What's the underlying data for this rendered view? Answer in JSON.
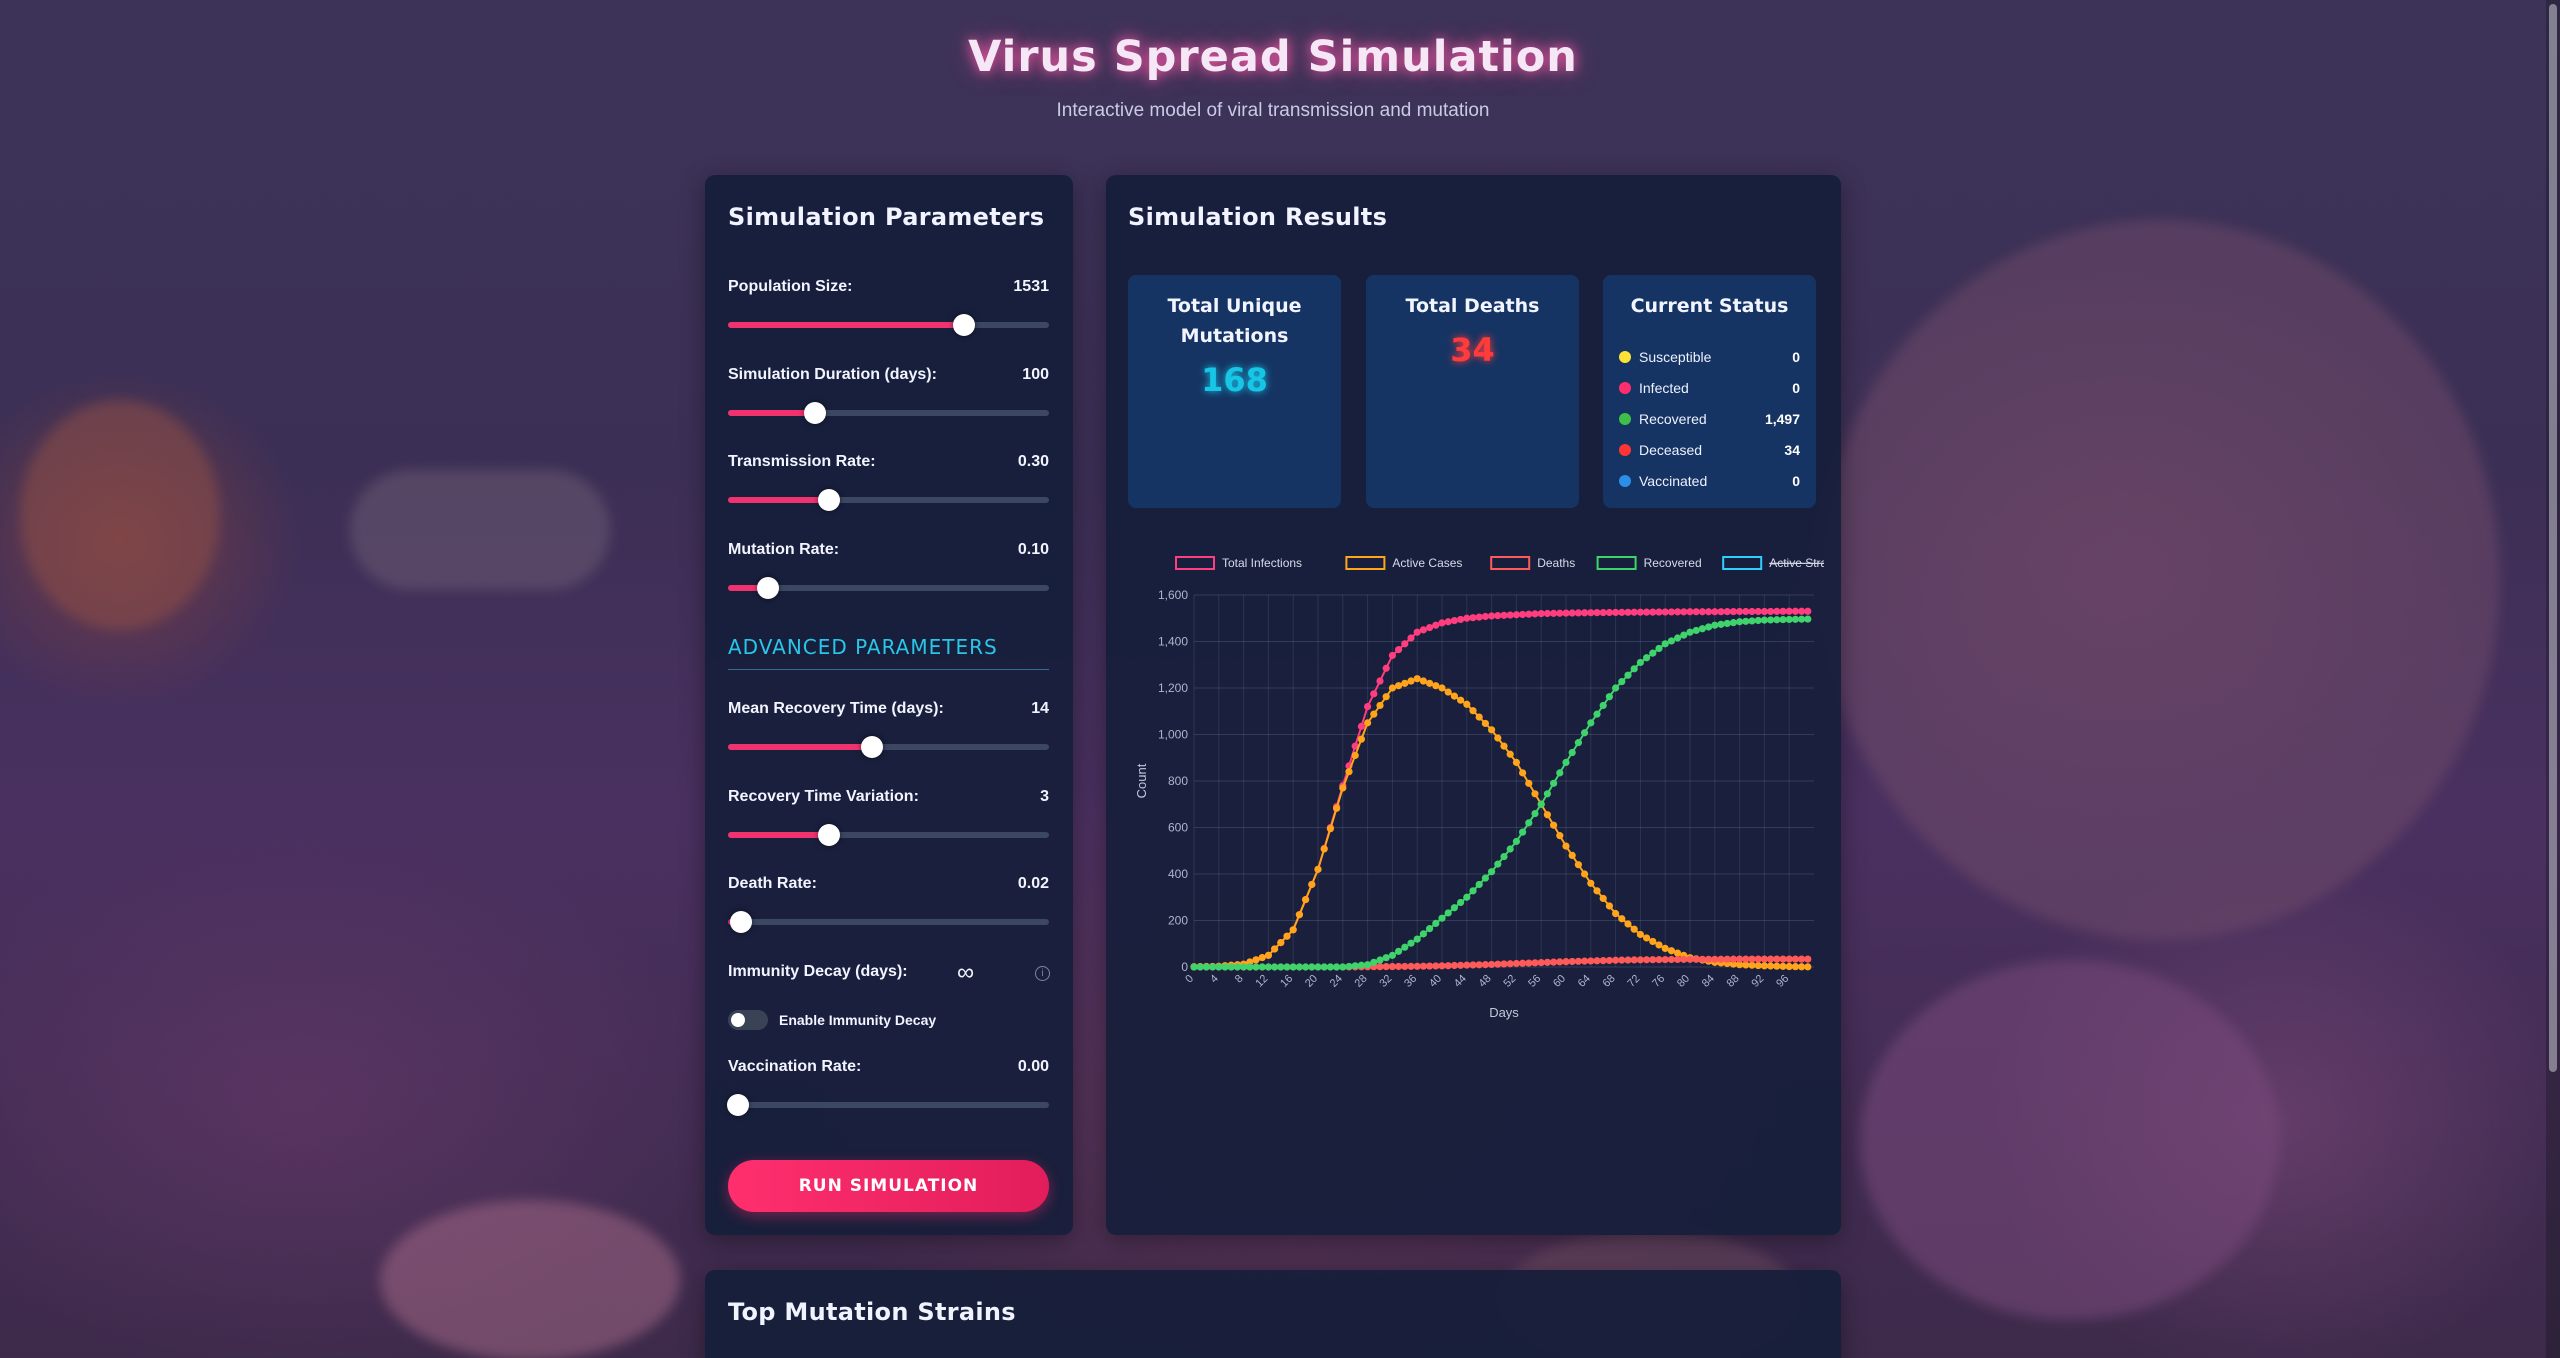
{
  "header": {
    "title": "Virus Spread Simulation",
    "subtitle": "Interactive model of viral transmission and mutation"
  },
  "params": {
    "title": "Simulation Parameters",
    "advanced_title": "ADVANCED PARAMETERS",
    "population": {
      "label": "Population Size:",
      "value": "1531",
      "fraction": 0.735
    },
    "duration": {
      "label": "Simulation Duration (days):",
      "value": "100",
      "fraction": 0.27
    },
    "transmission": {
      "label": "Transmission Rate:",
      "value": "0.30",
      "fraction": 0.315
    },
    "mutation": {
      "label": "Mutation Rate:",
      "value": "0.10",
      "fraction": 0.125
    },
    "recovery_time": {
      "label": "Mean Recovery Time (days):",
      "value": "14",
      "fraction": 0.45
    },
    "recovery_var": {
      "label": "Recovery Time Variation:",
      "value": "3",
      "fraction": 0.315
    },
    "death_rate": {
      "label": "Death Rate:",
      "value": "0.02",
      "fraction": 0.04
    },
    "immunity": {
      "label": "Immunity Decay (days):",
      "value": "∞",
      "info_icon": "info-icon"
    },
    "immunity_toggle": {
      "label": "Enable Immunity Decay",
      "enabled": false
    },
    "vaccination": {
      "label": "Vaccination Rate:",
      "value": "0.00",
      "fraction": 0.03
    },
    "run_label": "RUN SIMULATION"
  },
  "results": {
    "title": "Simulation Results",
    "mutations": {
      "title": "Total Unique Mutations",
      "value": "168",
      "color": "#17c6e6"
    },
    "deaths": {
      "title": "Total Deaths",
      "value": "34",
      "color": "#ff3b3b"
    },
    "status": {
      "title": "Current Status",
      "items": [
        {
          "name": "Susceptible",
          "value": "0",
          "color": "#ffe135"
        },
        {
          "name": "Infected",
          "value": "0",
          "color": "#ff2e6c"
        },
        {
          "name": "Recovered",
          "value": "1,497",
          "color": "#3fbf4a"
        },
        {
          "name": "Deceased",
          "value": "34",
          "color": "#ff3434"
        },
        {
          "name": "Vaccinated",
          "value": "0",
          "color": "#2b8fe8"
        }
      ]
    }
  },
  "strains": {
    "title": "Top Mutation Strains"
  },
  "chart_data": {
    "type": "line",
    "xlabel": "Days",
    "ylabel": "Count",
    "ylim": [
      0,
      1600
    ],
    "y_ticks": [
      "0",
      "200",
      "400",
      "600",
      "800",
      "1,000",
      "1,200",
      "1,400",
      "1,600"
    ],
    "x_ticks": [
      "0",
      "4",
      "8",
      "12",
      "16",
      "20",
      "24",
      "28",
      "32",
      "36",
      "40",
      "44",
      "48",
      "52",
      "56",
      "60",
      "64",
      "68",
      "72",
      "76",
      "80",
      "84",
      "88",
      "92",
      "96"
    ],
    "legend_position": "top",
    "grid": true,
    "series": [
      {
        "name": "Total Infections",
        "color": "#ff3d7f",
        "hidden": false,
        "values": [
          1,
          3,
          12,
          50,
          160,
          420,
          780,
          1120,
          1340,
          1440,
          1480,
          1500,
          1510,
          1515,
          1520,
          1522,
          1524,
          1525,
          1526,
          1527,
          1528,
          1528,
          1529,
          1529,
          1530
        ]
      },
      {
        "name": "Active Cases",
        "color": "#ffa41b",
        "hidden": false,
        "values": [
          1,
          3,
          12,
          50,
          160,
          420,
          770,
          1050,
          1200,
          1240,
          1200,
          1130,
          1020,
          880,
          700,
          520,
          360,
          230,
          140,
          80,
          40,
          20,
          10,
          5,
          2,
          0
        ]
      },
      {
        "name": "Deaths",
        "color": "#ff5a5a",
        "hidden": false,
        "values": [
          0,
          0,
          0,
          0,
          0,
          0,
          0,
          1,
          2,
          3,
          5,
          8,
          11,
          15,
          19,
          23,
          26,
          29,
          31,
          32,
          33,
          33,
          34,
          34,
          34
        ]
      },
      {
        "name": "Recovered",
        "color": "#3fd36c",
        "hidden": false,
        "values": [
          0,
          0,
          0,
          0,
          0,
          0,
          0,
          10,
          50,
          120,
          210,
          300,
          410,
          540,
          700,
          880,
          1050,
          1200,
          1310,
          1390,
          1440,
          1470,
          1485,
          1492,
          1495,
          1497
        ]
      },
      {
        "name": "Active Strains",
        "color": "#2fd0ff",
        "hidden": true,
        "values": []
      }
    ]
  }
}
